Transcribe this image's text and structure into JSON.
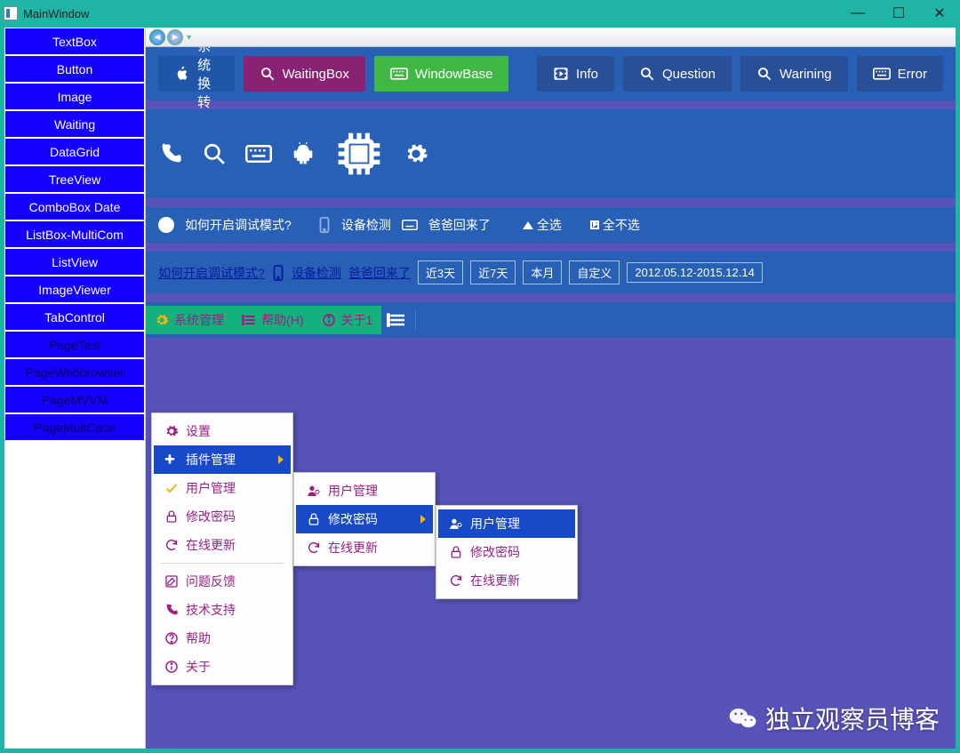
{
  "window": {
    "title": "MainWindow",
    "min": "—",
    "max": "☐",
    "close": "✕"
  },
  "sidebar": {
    "items": [
      {
        "label": "TextBox",
        "dark": false
      },
      {
        "label": "Button",
        "dark": false
      },
      {
        "label": "Image",
        "dark": false
      },
      {
        "label": "Waiting",
        "dark": false
      },
      {
        "label": "DataGrid",
        "dark": false
      },
      {
        "label": "TreeView",
        "dark": false
      },
      {
        "label": "ComboBox Date",
        "dark": false
      },
      {
        "label": "ListBox-MultiCom",
        "dark": false
      },
      {
        "label": "ListView",
        "dark": false
      },
      {
        "label": "ImageViewer",
        "dark": false
      },
      {
        "label": "TabControl",
        "dark": false
      },
      {
        "label": "PageTest",
        "dark": true
      },
      {
        "label": "PageWebbrowser",
        "dark": true
      },
      {
        "label": "PageMVVM",
        "dark": true
      },
      {
        "label": "PageMultCase",
        "dark": true
      }
    ]
  },
  "buttons": {
    "sys_switch": "系统换转",
    "waiting_box": "WaitingBox",
    "window_base": "WindowBase",
    "info": "Info",
    "question": "Question",
    "warning": "Warining",
    "error": "Error"
  },
  "link_row": {
    "how_debug": "如何开启调试模式?",
    "device_check": "设备检测",
    "dad_back": "爸爸回来了",
    "select_all": "全选",
    "select_none": "全不选"
  },
  "filter_row": {
    "how_debug": "如何开启调试模式?",
    "device_check": "设备检测",
    "dad_back": "爸爸回来了",
    "near3": "近3天",
    "near7": "近7天",
    "this_month": "本月",
    "custom": "自定义",
    "date_range": "2012.05.12-2015.12.14"
  },
  "menubar": {
    "sys_mgmt": "系统管理",
    "help": "帮助(H)",
    "about1": "关于1"
  },
  "menu1": {
    "settings": "设置",
    "plugin_mgmt": "插件管理",
    "user_mgmt": "用户管理",
    "change_pwd": "修改密码",
    "online_update": "在线更新",
    "feedback": "问题反馈",
    "tech_support": "技术支持",
    "help": "帮助",
    "about": "关于"
  },
  "menu2": {
    "user_mgmt": "用户管理",
    "change_pwd": "修改密码",
    "online_update": "在线更新"
  },
  "menu3": {
    "user_mgmt": "用户管理",
    "change_pwd": "修改密码",
    "online_update": "在线更新"
  },
  "watermark": "独立观察员博客"
}
